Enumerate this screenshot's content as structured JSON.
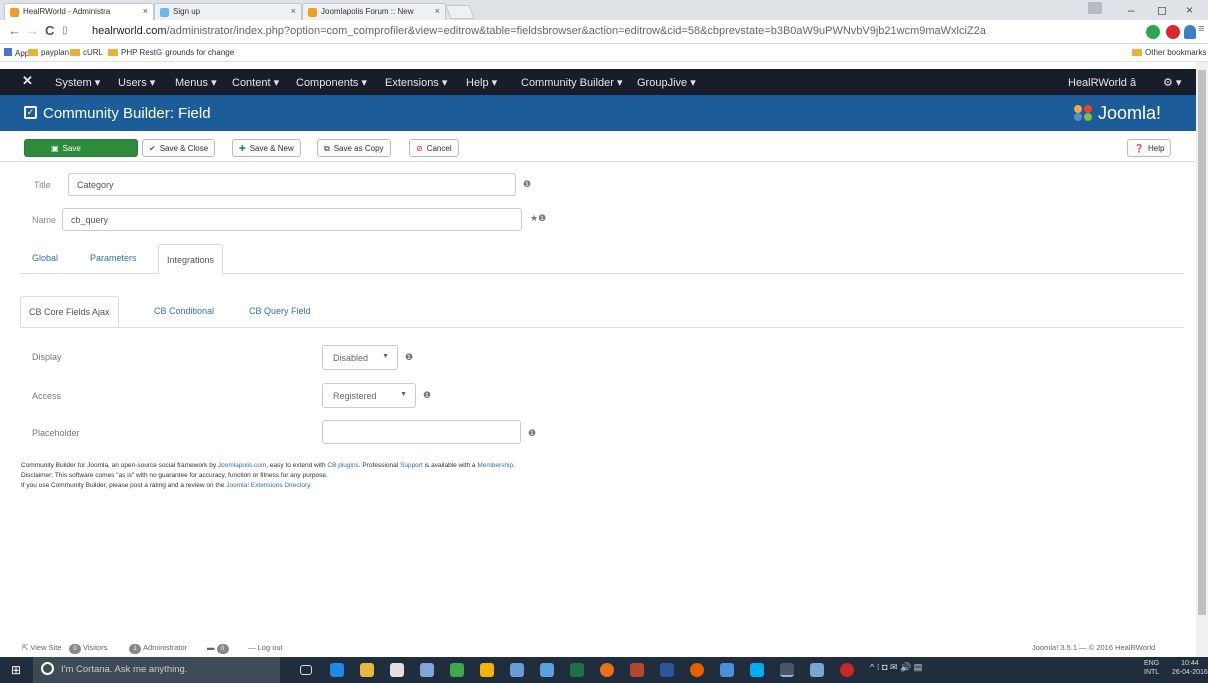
{
  "browser": {
    "tabs": [
      {
        "label": "HealRWorld - Administra",
        "active": true
      },
      {
        "label": "Sign up",
        "active": false
      },
      {
        "label": "Joomlapolis Forum :: New",
        "active": false
      }
    ],
    "url_host": "healrworld.com",
    "url_path": "/administrator/index.php?option=com_comprofiler&view=editrow&table=fieldsbrowser&action=editrow&cid=58&cbprevstate=b3B0aW9uPWNvbV9jb21wcm9maWxlciZ2a",
    "bookmarks": [
      "Apps",
      "payplan",
      "cURL",
      "PHP Rest",
      "grounds for change"
    ],
    "other_bookmarks": "Other bookmarks"
  },
  "joomla": {
    "menu": [
      "System",
      "Users",
      "Menus",
      "Content",
      "Components",
      "Extensions",
      "Help",
      "Community Builder",
      "GroupJive"
    ],
    "user": "HealRWorld â ",
    "page_title": "Community Builder: Field",
    "logo_text": "Joomla!"
  },
  "toolbar": {
    "save": "Save",
    "save_close": "Save & Close",
    "save_new": "Save & New",
    "save_copy": "Save as Copy",
    "cancel": "Cancel",
    "help": "Help"
  },
  "form": {
    "title_label": "Title",
    "title_value": "Category",
    "name_label": "Name",
    "name_value": "cb_query",
    "tabs": [
      "Global",
      "Parameters",
      "Integrations"
    ],
    "subtabs": [
      "CB Core Fields Ajax",
      "CB Conditional",
      "CB Query Field"
    ],
    "display_label": "Display",
    "display_value": "Disabled",
    "access_label": "Access",
    "access_value": "Registered",
    "placeholder_label": "Placeholder",
    "placeholder_value": ""
  },
  "footer": {
    "l1a": "Community Builder for Joomla, an open-source social framework by ",
    "l1b": "Joomlapolis.com",
    "l1c": ", easy to extend with ",
    "l1d": "CB plugins",
    "l1e": ". Professional ",
    "l1f": "Support",
    "l1g": " is available with a ",
    "l1h": "Membership",
    "l1i": ".",
    "l2": "Disclaimer: This software comes \"as is\" with no guarantee for accuracy, function or fitness for any purpose.",
    "l3a": "If you use Community Builder, please post a rating and a review on the ",
    "l3b": "Joomla! Extensions Directory",
    "l3c": "."
  },
  "status": {
    "view_site": "View Site",
    "visitors": "Visitors",
    "visitors_count": "0",
    "administrator": "Administrator",
    "admin_count": "1",
    "messages_count": "0",
    "logout": "Log out",
    "version": "Joomla! 3.5.1 — © 2016 HealRWorld"
  },
  "taskbar": {
    "cortana": "I'm Cortana. Ask me anything.",
    "lang1": "ENG",
    "lang2": "INTL",
    "time": "10:44",
    "date": "26-04-2016"
  },
  "colors": {
    "titlebar": "#1b5c99",
    "topnav": "#171d29",
    "save": "#2e8b3d",
    "link": "#3071a9",
    "taskbar": "#1f2d3d"
  }
}
